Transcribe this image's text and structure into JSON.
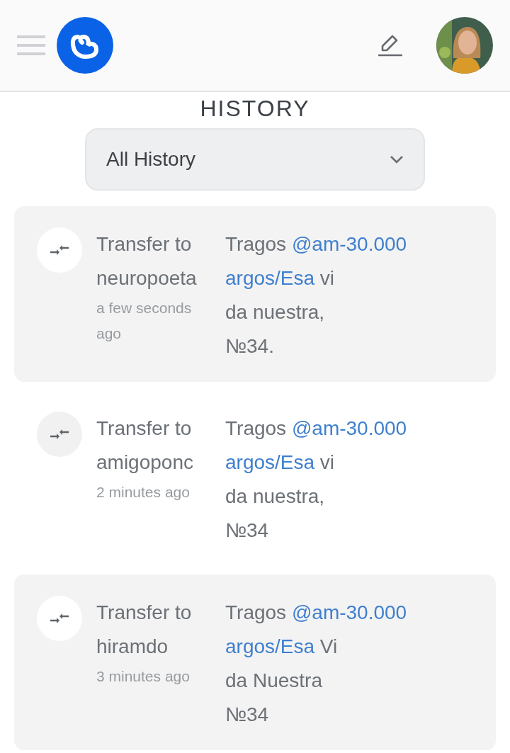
{
  "heading": "HISTORY",
  "filter": {
    "value": "All History"
  },
  "items": [
    {
      "highlighted": true,
      "title": "Transfer to neuropoeta",
      "time": "a few seconds ago",
      "memo": [
        [
          {
            "kind": "plain",
            "text": "Tragos "
          },
          {
            "kind": "link",
            "text": "@am-30.000"
          }
        ],
        [
          {
            "kind": "link",
            "text": "argos/Esa"
          },
          {
            "kind": "plain",
            "text": " vi"
          }
        ],
        [
          {
            "kind": "plain",
            "text": "da nuestra,"
          }
        ],
        [
          {
            "kind": "plain",
            "text": "№34."
          }
        ]
      ]
    },
    {
      "highlighted": false,
      "title": "Transfer to amigoponc",
      "time": "2 minutes ago",
      "memo": [
        [
          {
            "kind": "plain",
            "text": "Tragos "
          },
          {
            "kind": "link",
            "text": "@am-30.000"
          }
        ],
        [
          {
            "kind": "link",
            "text": "argos/Esa"
          },
          {
            "kind": "plain",
            "text": " vi"
          }
        ],
        [
          {
            "kind": "plain",
            "text": "da nuestra,"
          }
        ],
        [
          {
            "kind": "plain",
            "text": "№34"
          }
        ]
      ]
    },
    {
      "highlighted": true,
      "title": "Transfer to hiramdo",
      "time": "3 minutes ago",
      "memo": [
        [
          {
            "kind": "plain",
            "text": "Tragos "
          },
          {
            "kind": "link",
            "text": "@am-30.000"
          }
        ],
        [
          {
            "kind": "link",
            "text": "argos/Esa"
          },
          {
            "kind": "plain",
            "text": " Vi"
          }
        ],
        [
          {
            "kind": "plain",
            "text": "da Nuestra"
          }
        ],
        [
          {
            "kind": "plain",
            "text": "№34"
          }
        ]
      ]
    }
  ]
}
